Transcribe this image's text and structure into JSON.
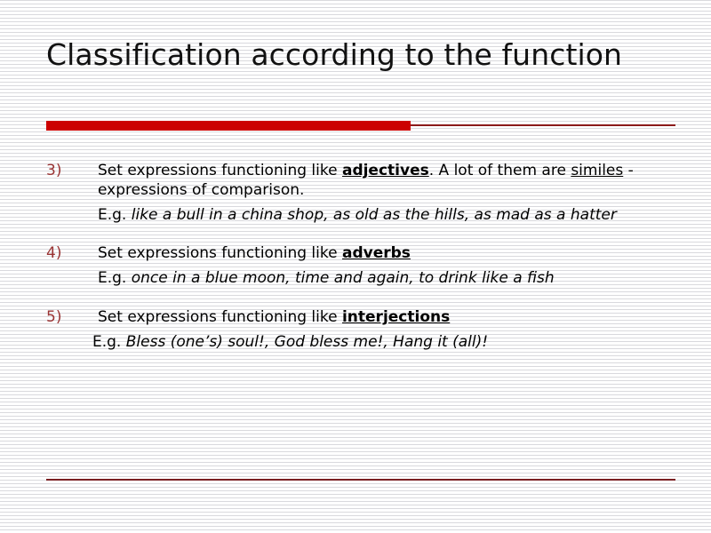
{
  "slide": {
    "title": "Classification according to the function",
    "theme": {
      "accent_red": "#cc0000",
      "accent_dark_red": "#8b1a1a",
      "marker_color": "#993333",
      "bottom_rule_color": "#7a1f22",
      "text_color": "#000000",
      "title_color": "#111111",
      "background": "#ffffff",
      "stripe_color": "#d9d9dd"
    },
    "items": [
      {
        "marker": "3)",
        "main": {
          "pre": "Set expressions functioning like ",
          "bold_underline": "adjectives",
          "mid": ". A lot of them are ",
          "underline": "similes",
          "post": " - expressions of comparison."
        },
        "example": {
          "label": "E.g. ",
          "italic": "like a bull in a china shop, as old as the hills, as mad as a hatter"
        }
      },
      {
        "marker": "4)",
        "main": {
          "pre": "Set expressions functioning like ",
          "bold_underline": "adverbs",
          "mid": "",
          "underline": "",
          "post": ""
        },
        "example": {
          "label": "E.g. ",
          "italic": "once in a blue moon, time and again, to drink like a fish"
        }
      },
      {
        "marker": "5)",
        "main": {
          "pre": "Set expressions functioning like ",
          "bold_underline": "interjections",
          "mid": "",
          "underline": "",
          "post": ""
        },
        "example": {
          "label": "E.g. ",
          "italic": "Bless (one’s) soul!, God bless me!, Hang it (all)!"
        }
      }
    ]
  }
}
